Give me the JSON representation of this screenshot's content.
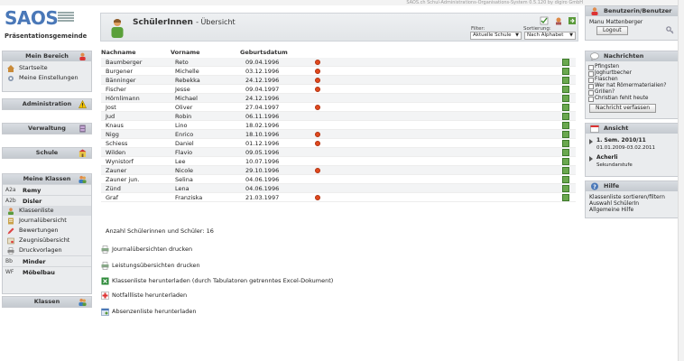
{
  "app": {
    "logo": "SAOS",
    "school": "Präsentationsgemeinde",
    "version_text": "SAOS.ch Schul-Administrations-Organisations-System 0.5.120 by digiro GmbH"
  },
  "sidebar": {
    "mein_bereich": {
      "title": "Mein Bereich",
      "items": [
        {
          "label": "Startseite",
          "icon": "home-icon"
        },
        {
          "label": "Meine Einstellungen",
          "icon": "settings-icon"
        }
      ]
    },
    "administration": "Administration",
    "verwaltung": "Verwaltung",
    "schule": "Schule",
    "meine_klassen": {
      "title": "Meine Klassen",
      "classes": [
        {
          "code": "A2a",
          "name": "Remy"
        },
        {
          "code": "A2b",
          "name": "Disler"
        }
      ],
      "items": [
        {
          "label": "Klassenliste",
          "icon": "people-icon"
        },
        {
          "label": "Journalübersicht",
          "icon": "journal-icon"
        },
        {
          "label": "Bewertungen",
          "icon": "pencil-icon"
        },
        {
          "label": "Zeugnisübersicht",
          "icon": "certificate-icon"
        },
        {
          "label": "Druckvorlagen",
          "icon": "printer-icon"
        }
      ],
      "classes2": [
        {
          "code": "Bb",
          "name": "Minder"
        },
        {
          "code": "WF",
          "name": "Möbelbau"
        }
      ]
    },
    "klassen": "Klassen"
  },
  "main": {
    "title": "SchülerInnen",
    "subtitle": "- Übersicht",
    "filter_label": "Filter:",
    "filter_value": "Aktuelle Schule",
    "sort_label": "Sortierung:",
    "sort_value": "Nach Alphabet",
    "columns": {
      "last": "Nachname",
      "first": "Vorname",
      "birth": "Geburtsdatum"
    },
    "rows": [
      {
        "last": "Baumberger",
        "first": "Reto",
        "birth": "09.04.1996",
        "flag": true
      },
      {
        "last": "Burgener",
        "first": "Michelle",
        "birth": "03.12.1996",
        "flag": true
      },
      {
        "last": "Bänninger",
        "first": "Rebekka",
        "birth": "24.12.1996",
        "flag": true
      },
      {
        "last": "Fischer",
        "first": "Jesse",
        "birth": "09.04.1997",
        "flag": true
      },
      {
        "last": "Hörnlimann",
        "first": "Michael",
        "birth": "24.12.1996",
        "flag": false
      },
      {
        "last": "Jost",
        "first": "Oliver",
        "birth": "27.04.1997",
        "flag": true
      },
      {
        "last": "Jud",
        "first": "Robin",
        "birth": "06.11.1996",
        "flag": false
      },
      {
        "last": "Knaus",
        "first": "Lino",
        "birth": "18.02.1996",
        "flag": false
      },
      {
        "last": "Nigg",
        "first": "Enrico",
        "birth": "18.10.1996",
        "flag": true
      },
      {
        "last": "Schiess",
        "first": "Daniel",
        "birth": "01.12.1996",
        "flag": true
      },
      {
        "last": "Wilden",
        "first": "Flavio",
        "birth": "09.05.1996",
        "flag": false
      },
      {
        "last": "Wynistorf",
        "first": "Lee",
        "birth": "10.07.1996",
        "flag": false
      },
      {
        "last": "Zauner",
        "first": "Nicole",
        "birth": "29.10.1996",
        "flag": true
      },
      {
        "last": "Zauner jun.",
        "first": "Selina",
        "birth": "04.06.1996",
        "flag": false
      },
      {
        "last": "Zünd",
        "first": "Lena",
        "birth": "04.06.1996",
        "flag": false
      },
      {
        "last": "Graf",
        "first": "Franziska",
        "birth": "21.03.1997",
        "flag": true
      }
    ],
    "count_text": "Anzahl Schülerinnen und Schüler: 16",
    "links": [
      {
        "label": "Journalübersichten drucken",
        "icon": "print-icon"
      },
      {
        "label": "Leistungsübersichten drucken",
        "icon": "print-icon"
      },
      {
        "label": "Klassenliste herunterladen (durch Tabulatoren getrenntes Excel-Dokument)",
        "icon": "excel-icon"
      },
      {
        "label": "Notfallliste herunterladen",
        "icon": "emergency-icon"
      },
      {
        "label": "Absenzenliste herunterladen",
        "icon": "absence-icon"
      }
    ]
  },
  "right": {
    "user": {
      "title": "Benutzerin/Benutzer",
      "name": "Manu Mattenberger",
      "logout": "Logout"
    },
    "news": {
      "title": "Nachrichten",
      "items": [
        "Pfingsten",
        "Joghurtbecher",
        "Flaschen",
        "Wer hat Römermaterialien?",
        "Grillen?",
        "Christian fehlt heute"
      ],
      "compose": "Nachricht verfassen"
    },
    "view": {
      "title": "Ansicht",
      "semester": "1. Sem. 2010/11",
      "semester_dates": "01.01.2009-03.02.2011",
      "school": "Acherli",
      "level": "Sekundarstufe"
    },
    "help": {
      "title": "Hilfe",
      "items": [
        "Klassenliste sortieren/filtern",
        "Auswahl SchülerIn",
        "Allgemeine Hilfe"
      ]
    }
  },
  "colors": {
    "accent": "#4a78b8",
    "flag": "#e24a1e",
    "panel": "#eaecee"
  }
}
